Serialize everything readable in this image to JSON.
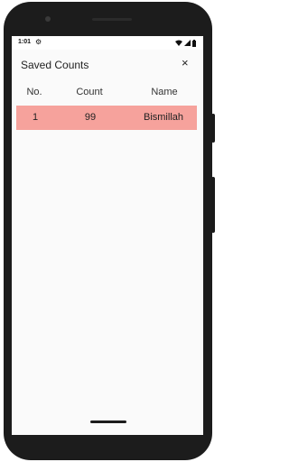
{
  "status_bar": {
    "time": "1:01",
    "settings_icon": "gear-icon",
    "wifi_icon": "wifi-icon",
    "signal_icon": "signal-icon",
    "battery_icon": "battery-icon"
  },
  "dialog": {
    "title": "Saved Counts",
    "close_label": "×"
  },
  "table": {
    "headers": [
      "No.",
      "Count",
      "Name"
    ],
    "rows": [
      {
        "no": "1",
        "count": "99",
        "name": "Bismillah",
        "highlight_color": "#f6a29c"
      }
    ]
  }
}
